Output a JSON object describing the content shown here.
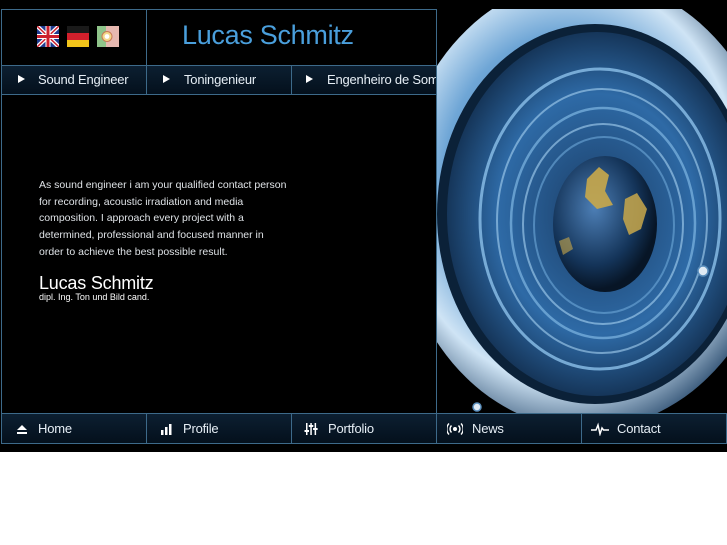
{
  "header": {
    "title": "Lucas Schmitz",
    "languages": [
      {
        "name": "English",
        "icon": "uk-flag-icon"
      },
      {
        "name": "Deutsch",
        "icon": "german-flag-icon"
      },
      {
        "name": "Português",
        "icon": "portuguese-flag-icon"
      }
    ]
  },
  "nav": {
    "items": [
      {
        "label": "Sound Engineer",
        "icon": "play-triangle-icon"
      },
      {
        "label": "Toningenieur",
        "icon": "play-triangle-icon"
      },
      {
        "label": "Engenheiro de Som",
        "icon": "play-triangle-icon"
      }
    ]
  },
  "main": {
    "intro": "As sound engineer i am your qualified contact person for recording, acoustic irradiation and media composition. I approach every project with a determined, professional and focused manner in order to achieve the best possible result.",
    "signature_name": "Lucas Schmitz",
    "signature_title": "dipl. Ing. Ton und Bild cand."
  },
  "footer": {
    "items": [
      {
        "label": "Home",
        "icon": "eject-home-icon"
      },
      {
        "label": "Profile",
        "icon": "bar-chart-icon"
      },
      {
        "label": "Portfolio",
        "icon": "mixer-sliders-icon"
      },
      {
        "label": "News",
        "icon": "broadcast-icon"
      },
      {
        "label": "Contact",
        "icon": "pulse-icon"
      }
    ]
  },
  "colors": {
    "accent": "#4a9fdc",
    "border": "#3d6a8a",
    "background": "#000000"
  }
}
